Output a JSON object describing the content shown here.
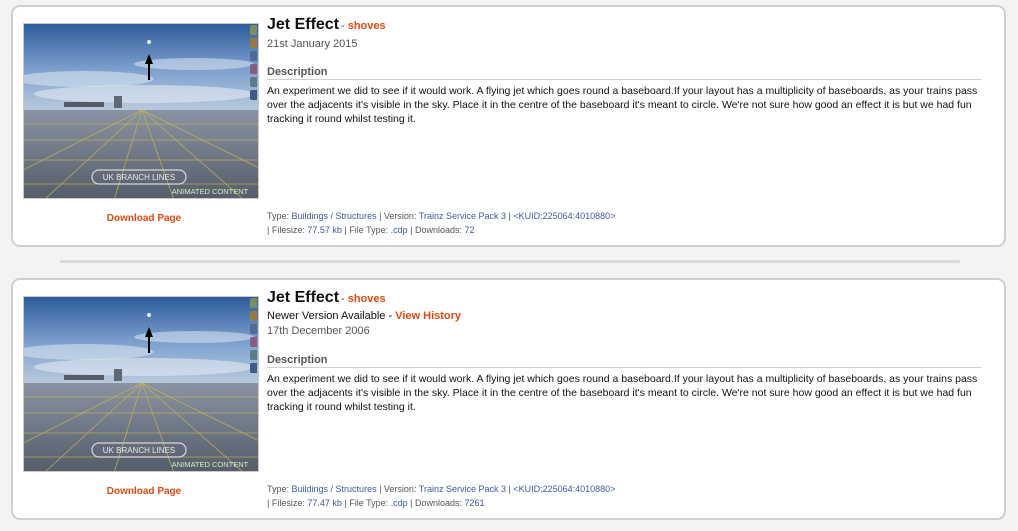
{
  "listings": [
    {
      "title": "Jet Effect",
      "separator": "-",
      "author": "shoves",
      "newer_version_text": "",
      "view_history_label": "",
      "date": "21st January 2015",
      "description_heading": "Description",
      "description": "An experiment we did to see if it would work. A flying jet which goes round a baseboard.If your layout has a multiplicity of baseboards, as your trains pass over the adjacents it's visible in the sky. Place it in the centre of the baseboard it's meant to circle. We're not sure how good an effect it is but we had fun tracking it round whilst testing it.",
      "download_label": "Download Page",
      "thumb_caption": "UK BRANCH LINES",
      "thumb_badge": "ANIMATED CONTENT",
      "type_label": "Type:",
      "type_value": "Buildings / Structures",
      "version_label": "Version:",
      "version_value": "Trainz Service Pack 3",
      "kuid": "<KUID:225064:4010880>",
      "filesize_label": "Filesize:",
      "filesize_value": "77.57 kb",
      "filetype_label": "File Type:",
      "filetype_value": ".cdp",
      "downloads_label": "Downloads:",
      "downloads_value": "72"
    },
    {
      "title": "Jet Effect",
      "separator": "-",
      "author": "shoves",
      "newer_version_text": "Newer Version Available -",
      "view_history_label": "View History",
      "date": "17th December 2006",
      "description_heading": "Description",
      "description": "An experiment we did to see if it would work. A flying jet which goes round a baseboard.If your layout has a multiplicity of baseboards, as your trains pass over the adjacents it's visible in the sky. Place it in the centre of the baseboard it's meant to circle. We're not sure how good an effect it is but we had fun tracking it round whilst testing it.",
      "download_label": "Download Page",
      "thumb_caption": "UK BRANCH LINES",
      "thumb_badge": "ANIMATED CONTENT",
      "type_label": "Type:",
      "type_value": "Buildings / Structures",
      "version_label": "Version:",
      "version_value": "Trainz Service Pack 3",
      "kuid": "<KUID:225064:4010880>",
      "filesize_label": "Filesize:",
      "filesize_value": "77.47 kb",
      "filetype_label": "File Type:",
      "filetype_value": ".cdp",
      "downloads_label": "Downloads:",
      "downloads_value": "7261"
    }
  ],
  "colors": {
    "accent": "#e04a12",
    "link": "#3c5aa0",
    "card_border": "#cfcfcf"
  }
}
